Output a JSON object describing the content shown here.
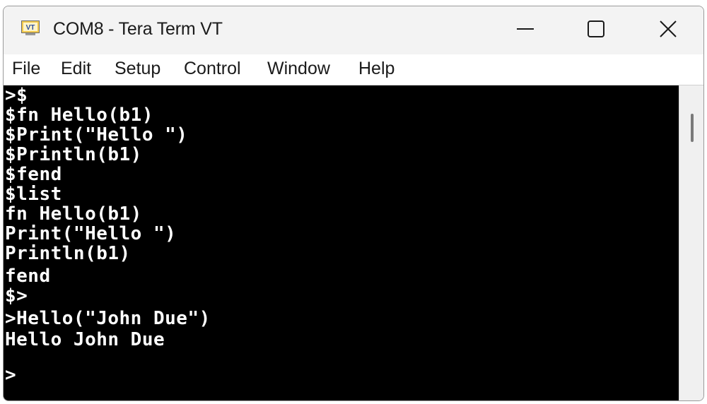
{
  "window": {
    "title": "COM8 - Tera Term VT",
    "icon_text": "VT",
    "icon_name": "tera-term-vt-icon",
    "controls": [
      "minimize-icon",
      "maximize-icon",
      "close-icon"
    ]
  },
  "menu": {
    "items": [
      {
        "label": "File"
      },
      {
        "label": "Edit"
      },
      {
        "label": "Setup"
      },
      {
        "label": "Control"
      },
      {
        "label": "Window"
      },
      {
        "label": "Help"
      }
    ]
  },
  "terminal": {
    "background": "#000000",
    "foreground": "#ffffff",
    "lines": [
      ">$",
      "$fn Hello(b1)",
      "$Print(\"Hello \")",
      "$Println(b1)",
      "$fend",
      "$list",
      "fn Hello(b1)",
      "Print(\"Hello \")",
      "Println(b1)",
      "fend",
      "$>",
      ">Hello(\"John Due\")",
      "Hello John Due",
      ">"
    ]
  },
  "colors": {
    "titlebar": "#f3f3f3",
    "menubar": "#ffffff",
    "icon_bg": "#f2c94c",
    "icon_fg": "#2d4f9e"
  }
}
